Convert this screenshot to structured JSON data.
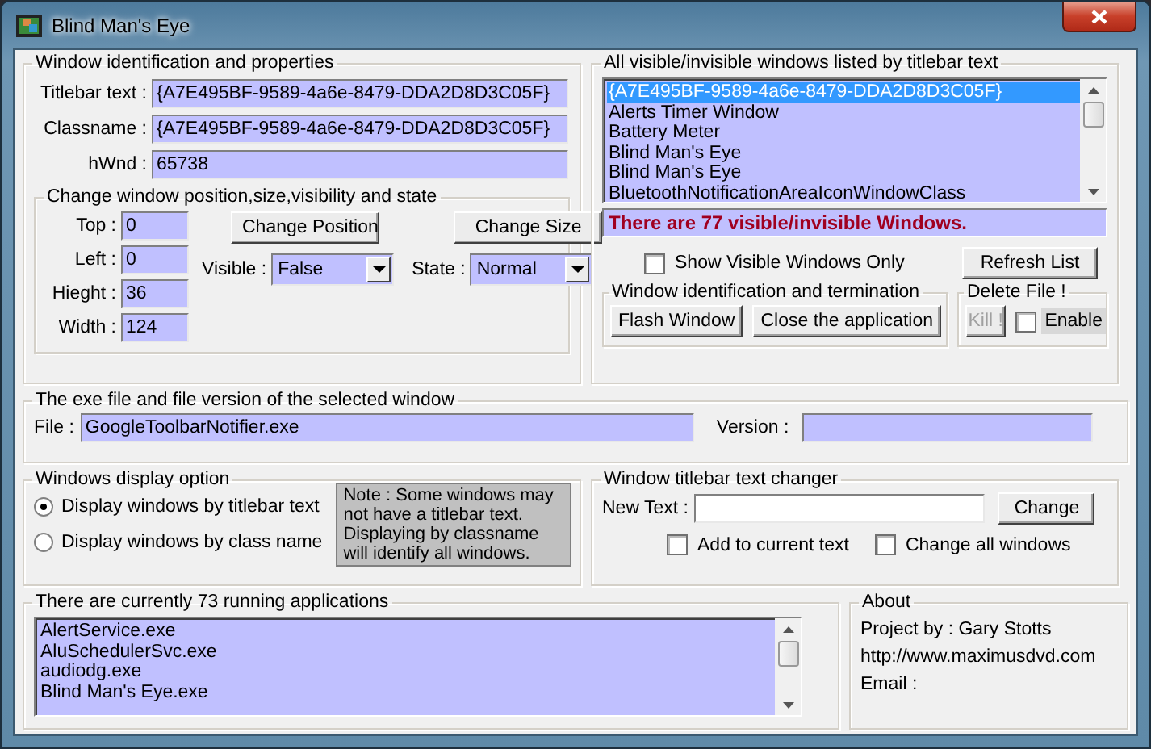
{
  "window": {
    "title": "Blind Man's Eye"
  },
  "identification": {
    "legend": "Window identification and properties",
    "fields": [
      {
        "label": "Titlebar text :",
        "value": "{A7E495BF-9589-4a6e-8479-DDA2D8D3C05F}"
      },
      {
        "label": "Classname :",
        "value": "{A7E495BF-9589-4a6e-8479-DDA2D8D3C05F}"
      },
      {
        "label": "hWnd :",
        "value": "65738"
      }
    ]
  },
  "position": {
    "legend": "Change window position,size,visibility and state",
    "fields": [
      {
        "label": "Top :",
        "value": "0"
      },
      {
        "label": "Left :",
        "value": "0"
      },
      {
        "label": "Hieght :",
        "value": "36"
      },
      {
        "label": "Width :",
        "value": "124"
      }
    ],
    "buttons": [
      "Change Position",
      "Change Size"
    ],
    "dropdowns": [
      {
        "label": "Visible :",
        "value": "False"
      },
      {
        "label": "State :",
        "value": "Normal"
      }
    ]
  },
  "window_list": {
    "legend": "All visible/invisible windows listed by titlebar text",
    "items": [
      {
        "text": "{A7E495BF-9589-4a6e-8479-DDA2D8D3C05F}",
        "selected": true
      },
      {
        "text": "Alerts Timer Window",
        "selected": false
      },
      {
        "text": "Battery Meter",
        "selected": false
      },
      {
        "text": "Blind Man's Eye",
        "selected": false
      },
      {
        "text": "Blind Man's Eye",
        "selected": false
      },
      {
        "text": "BluetoothNotificationAreaIconWindowClass",
        "selected": false
      }
    ],
    "count_text": "There are 77 visible/invisible Windows.",
    "show_visible_only": {
      "label": "Show Visible Windows Only",
      "checked": false
    },
    "refresh_button": "Refresh List"
  },
  "termination": {
    "legend": "Window identification and termination",
    "buttons": [
      "Flash Window",
      "Close the application"
    ]
  },
  "delete_file": {
    "legend": "Delete File !",
    "kill_button": {
      "label": "Kill !",
      "disabled": true
    },
    "enable": {
      "label": "Enable",
      "checked": false
    }
  },
  "exe": {
    "legend": "The exe file and file version of the selected window",
    "file_label": "File :",
    "file_value": "GoogleToolbarNotifier.exe",
    "version_label": "Version :"
  },
  "display_option": {
    "legend": "Windows display option",
    "options": [
      {
        "label": "Display windows by titlebar text",
        "selected": true
      },
      {
        "label": "Display windows by class name",
        "selected": false
      }
    ],
    "note": "Note : Some windows may not have a titlebar text. Displaying by classname will identify all windows."
  },
  "title_changer": {
    "legend": "Window titlebar text changer",
    "new_text_label": "New Text :",
    "change_button": "Change",
    "checkboxes": [
      {
        "label": "Add to current text",
        "checked": false
      },
      {
        "label": "Change all windows",
        "checked": false
      }
    ]
  },
  "applications": {
    "legend": "There are currently 73 running applications",
    "items": [
      {
        "text": "AlertService.exe"
      },
      {
        "text": "AluSchedulerSvc.exe"
      },
      {
        "text": "audiodg.exe"
      },
      {
        "text": "Blind Man's Eye.exe"
      }
    ]
  },
  "about": {
    "legend": "About",
    "lines": [
      "Project by : Gary Stotts",
      "http://www.maximusdvd.com",
      "Email :"
    ]
  }
}
